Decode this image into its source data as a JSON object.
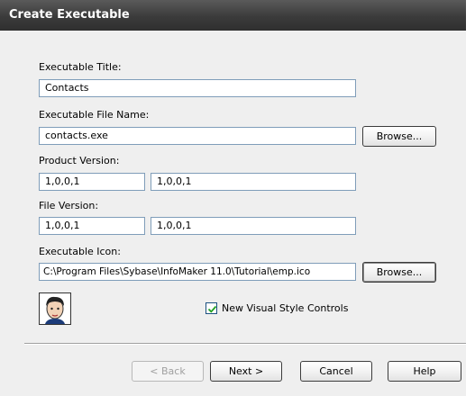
{
  "window": {
    "title": "Create Executable"
  },
  "fields": {
    "exe_title_label": "Executable Title:",
    "exe_title_value": "Contacts",
    "exe_file_label": "Executable File Name:",
    "exe_file_value": "contacts.exe",
    "product_version_label": "Product Version:",
    "product_version_1": "1,0,0,1",
    "product_version_2": "1,0,0,1",
    "file_version_label": "File Version:",
    "file_version_1": "1,0,0,1",
    "file_version_2": "1,0,0,1",
    "exe_icon_label": "Executable Icon:",
    "exe_icon_value": "C:\\Program Files\\Sybase\\InfoMaker 11.0\\Tutorial\\emp.ico"
  },
  "buttons": {
    "browse_1": "Browse...",
    "browse_2": "Browse...",
    "back": "< Back",
    "next": "Next >",
    "cancel": "Cancel",
    "help": "Help"
  },
  "checkbox": {
    "label": "New Visual Style Controls",
    "checked": true
  },
  "icons": {
    "preview": "employee-face-icon",
    "check": "checkmark-icon"
  }
}
